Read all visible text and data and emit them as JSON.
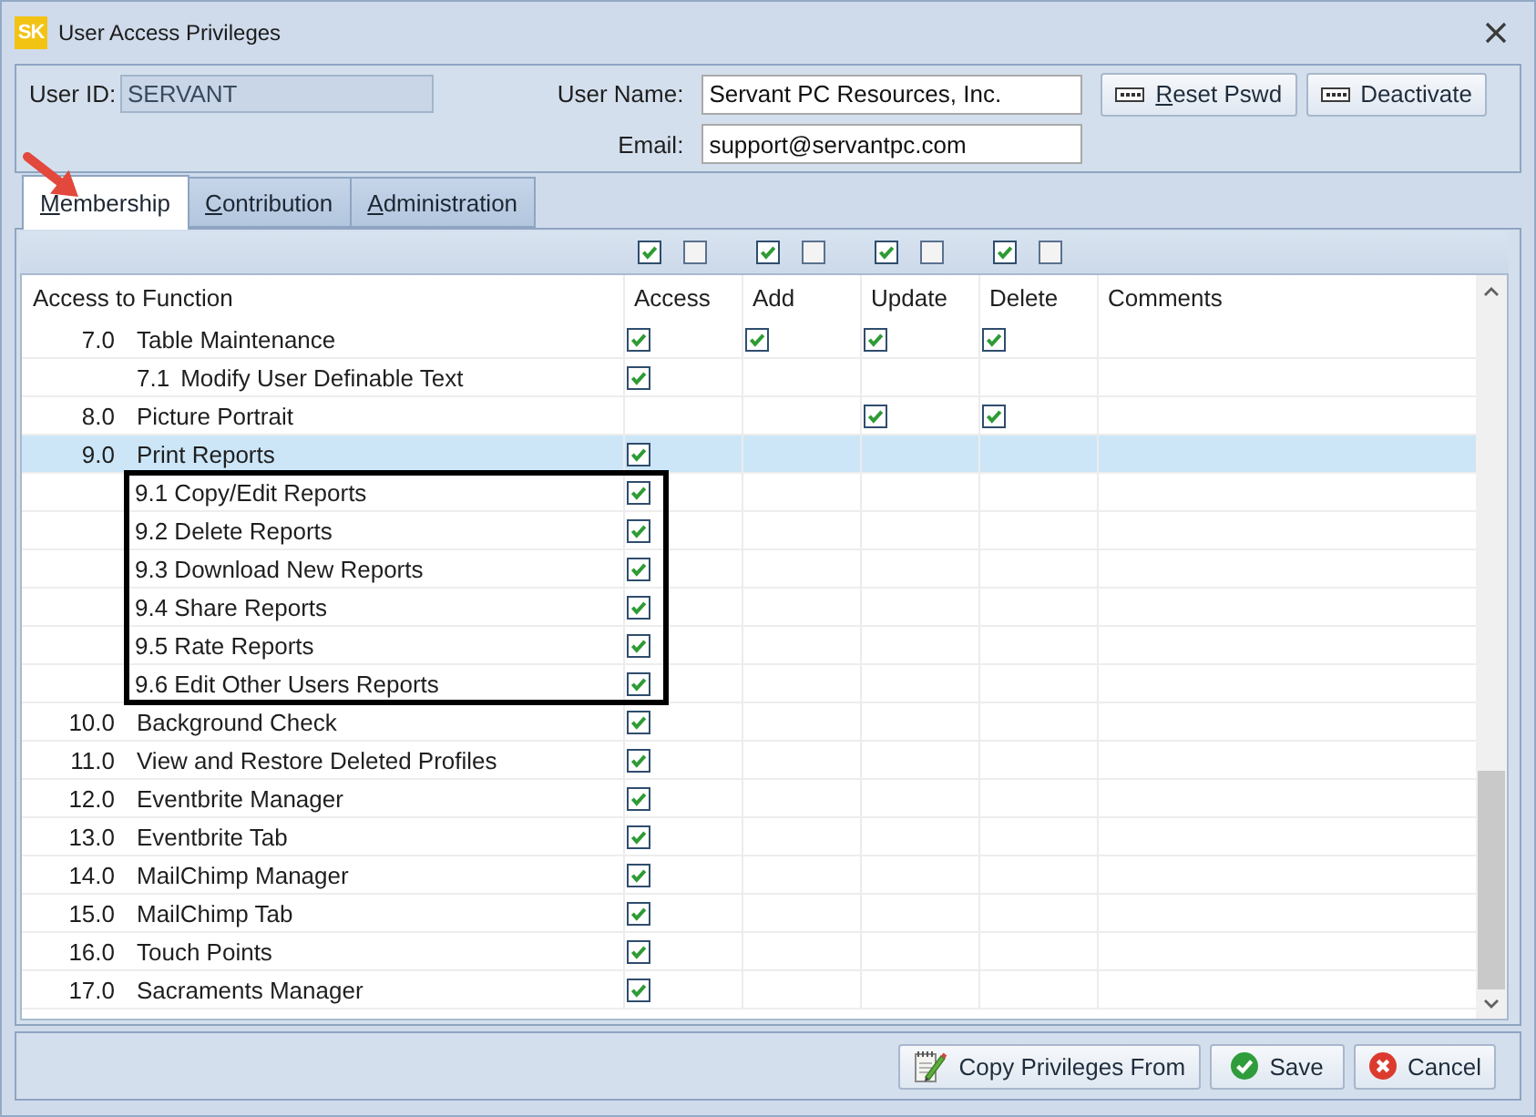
{
  "window": {
    "badge": "SK",
    "title": "User Access Privileges"
  },
  "user": {
    "id_label": "User ID:",
    "id_value": "SERVANT",
    "name_label": "User Name:",
    "name_value": "Servant PC Resources, Inc.",
    "email_label": "Email:",
    "email_value": "support@servantpc.com"
  },
  "actions": [
    {
      "kind": "password",
      "label": "Reset Pswd",
      "underlined_key": true
    },
    {
      "kind": "password",
      "label": "Deactivate",
      "underlined_key": false
    }
  ],
  "tabs": [
    {
      "label": "Membership",
      "selected": true,
      "underlined_key": true,
      "pointed_at": true
    },
    {
      "label": "Contribution",
      "selected": false,
      "underlined_key": true,
      "pointed_at": false
    },
    {
      "label": "Administration",
      "selected": false,
      "underlined_key": true,
      "pointed_at": false
    }
  ],
  "table": {
    "columns": [
      {
        "kind": "label",
        "label": "Access to Function"
      },
      {
        "kind": "check",
        "label": "Access",
        "toggles": [
          {
            "checked": true
          },
          {
            "checked": false
          }
        ]
      },
      {
        "kind": "check",
        "label": "Add",
        "toggles": [
          {
            "checked": true
          },
          {
            "checked": false
          }
        ]
      },
      {
        "kind": "check",
        "label": "Update",
        "toggles": [
          {
            "checked": true
          },
          {
            "checked": false
          }
        ]
      },
      {
        "kind": "check",
        "label": "Delete",
        "toggles": [
          {
            "checked": true
          },
          {
            "checked": false
          }
        ]
      },
      {
        "kind": "text",
        "label": "Comments"
      }
    ],
    "rows": [
      {
        "number": "7.0",
        "name": "Table Maintenance",
        "selected": false,
        "checks": [
          {
            "checked": true
          },
          {
            "checked": true
          },
          {
            "checked": true
          },
          {
            "checked": true
          }
        ],
        "children_framed": false,
        "children": [
          {
            "number": "7.1",
            "name": "Modify User Definable Text",
            "selected": false,
            "checks": [
              {
                "checked": true
              },
              {
                "checked": false
              },
              {
                "checked": false
              },
              {
                "checked": false
              }
            ]
          }
        ]
      },
      {
        "number": "8.0",
        "name": "Picture Portrait",
        "selected": false,
        "checks": [
          {
            "checked": false
          },
          {
            "checked": false
          },
          {
            "checked": true
          },
          {
            "checked": true
          }
        ]
      },
      {
        "number": "9.0",
        "name": "Print Reports",
        "selected": true,
        "checks": [
          {
            "checked": true
          },
          {
            "checked": false
          },
          {
            "checked": false
          },
          {
            "checked": false
          }
        ],
        "children_framed": true,
        "children": [
          {
            "label": "9.1 Copy/Edit Reports",
            "selected": false,
            "checks": [
              {
                "checked": true
              },
              {
                "checked": false
              },
              {
                "checked": false
              },
              {
                "checked": false
              }
            ]
          },
          {
            "label": "9.2 Delete Reports",
            "selected": false,
            "checks": [
              {
                "checked": true
              },
              {
                "checked": false
              },
              {
                "checked": false
              },
              {
                "checked": false
              }
            ]
          },
          {
            "label": "9.3 Download New Reports",
            "selected": false,
            "checks": [
              {
                "checked": true
              },
              {
                "checked": false
              },
              {
                "checked": false
              },
              {
                "checked": false
              }
            ]
          },
          {
            "label": "9.4 Share Reports",
            "selected": false,
            "checks": [
              {
                "checked": true
              },
              {
                "checked": false
              },
              {
                "checked": false
              },
              {
                "checked": false
              }
            ]
          },
          {
            "label": "9.5 Rate Reports",
            "selected": false,
            "checks": [
              {
                "checked": true
              },
              {
                "checked": false
              },
              {
                "checked": false
              },
              {
                "checked": false
              }
            ]
          },
          {
            "label": "9.6 Edit Other Users Reports",
            "selected": false,
            "checks": [
              {
                "checked": true
              },
              {
                "checked": false
              },
              {
                "checked": false
              },
              {
                "checked": false
              }
            ]
          }
        ]
      },
      {
        "number": "10.0",
        "name": "Background Check",
        "selected": false,
        "checks": [
          {
            "checked": true
          },
          {
            "checked": false
          },
          {
            "checked": false
          },
          {
            "checked": false
          }
        ]
      },
      {
        "number": "11.0",
        "name": "View and Restore Deleted Profiles",
        "selected": false,
        "checks": [
          {
            "checked": true
          },
          {
            "checked": false
          },
          {
            "checked": false
          },
          {
            "checked": false
          }
        ]
      },
      {
        "number": "12.0",
        "name": "Eventbrite Manager",
        "selected": false,
        "checks": [
          {
            "checked": true
          },
          {
            "checked": false
          },
          {
            "checked": false
          },
          {
            "checked": false
          }
        ]
      },
      {
        "number": "13.0",
        "name": "Eventbrite Tab",
        "selected": false,
        "checks": [
          {
            "checked": true
          },
          {
            "checked": false
          },
          {
            "checked": false
          },
          {
            "checked": false
          }
        ]
      },
      {
        "number": "14.0",
        "name": "MailChimp Manager",
        "selected": false,
        "checks": [
          {
            "checked": true
          },
          {
            "checked": false
          },
          {
            "checked": false
          },
          {
            "checked": false
          }
        ]
      },
      {
        "number": "15.0",
        "name": "MailChimp Tab",
        "selected": false,
        "checks": [
          {
            "checked": true
          },
          {
            "checked": false
          },
          {
            "checked": false
          },
          {
            "checked": false
          }
        ]
      },
      {
        "number": "16.0",
        "name": "Touch Points",
        "selected": false,
        "checks": [
          {
            "checked": true
          },
          {
            "checked": false
          },
          {
            "checked": false
          },
          {
            "checked": false
          }
        ]
      },
      {
        "number": "17.0",
        "name": "Sacraments Manager",
        "selected": false,
        "checks": [
          {
            "checked": true
          },
          {
            "checked": false
          },
          {
            "checked": false
          },
          {
            "checked": false
          }
        ]
      }
    ]
  },
  "footer_buttons": [
    {
      "kind": "copy",
      "label": "Copy Privileges From"
    },
    {
      "kind": "save",
      "label": "Save"
    },
    {
      "kind": "cancel",
      "label": "Cancel"
    }
  ]
}
